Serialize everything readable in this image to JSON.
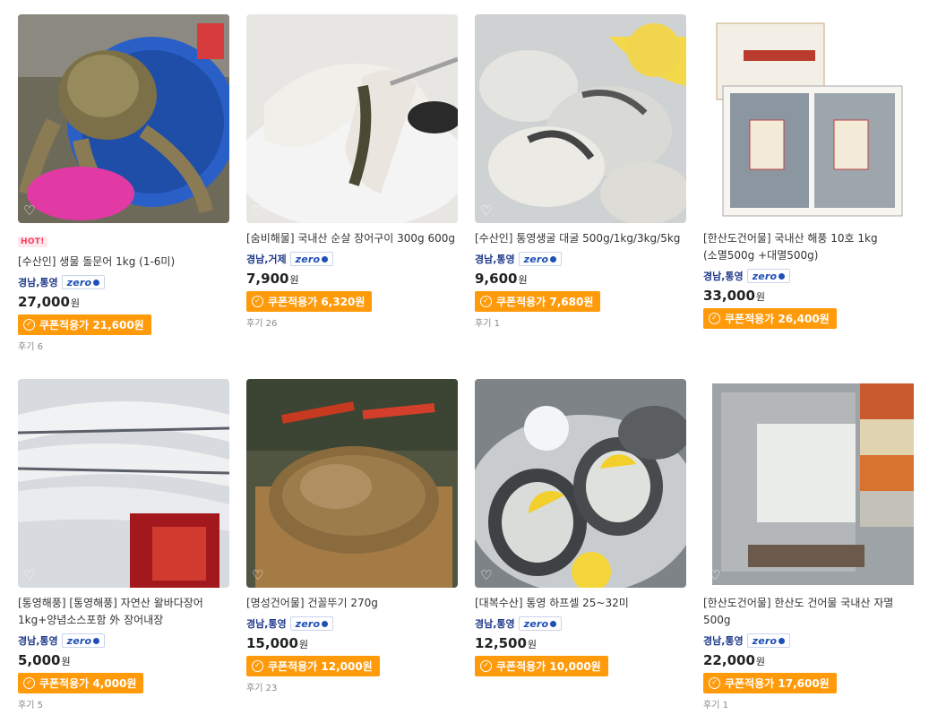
{
  "products": [
    {
      "hot": "HOT!",
      "title": "[수산인] 생물 돌문어 1kg (1-6미)",
      "location": "경남,통영",
      "badge": "zero",
      "price": "27,000",
      "unit": "원",
      "coupon": "쿠폰적용가 21,600원",
      "review": "후기 6"
    },
    {
      "hot": "",
      "title": "[숨비해물] 국내산 순살 장어구이 300g 600g",
      "location": "경남,거제",
      "badge": "zero",
      "price": "7,900",
      "unit": "원",
      "coupon": "쿠폰적용가 6,320원",
      "review": "후기 26"
    },
    {
      "hot": "",
      "title": "[수산인] 통영생굴 대굴 500g/1kg/3kg/5kg",
      "location": "경남,통영",
      "badge": "zero",
      "price": "9,600",
      "unit": "원",
      "coupon": "쿠폰적용가 7,680원",
      "review": "후기 1"
    },
    {
      "hot": "",
      "title": "[한산도건어물] 국내산 해풍 10호 1kg (소멸500g +대멸500g)",
      "location": "경남,통영",
      "badge": "zero",
      "price": "33,000",
      "unit": "원",
      "coupon": "쿠폰적용가 26,400원",
      "review": ""
    },
    {
      "hot": "",
      "title": "[통영해풍] [통영해풍] 자연산 왈바다장어 1kg+양념소스포함 外 장어내장",
      "location": "경남,통영",
      "badge": "zero",
      "price": "5,000",
      "unit": "원",
      "coupon": "쿠폰적용가 4,000원",
      "review": "후기 5"
    },
    {
      "hot": "",
      "title": "[명성건어물] 건꼴뚜기 270g",
      "location": "경남,통영",
      "badge": "zero",
      "price": "15,000",
      "unit": "원",
      "coupon": "쿠폰적용가 12,000원",
      "review": "후기 23"
    },
    {
      "hot": "",
      "title": "[대복수산] 통영 하프셀 25~32미",
      "location": "경남,통영",
      "badge": "zero",
      "price": "12,500",
      "unit": "원",
      "coupon": "쿠폰적용가 10,000원",
      "review": ""
    },
    {
      "hot": "",
      "title": "[한산도건어물] 한산도 건어물 국내산 자멸 500g",
      "location": "경남,통영",
      "badge": "zero",
      "price": "22,000",
      "unit": "원",
      "coupon": "쿠폰적용가 17,600원",
      "review": "후기 1"
    }
  ],
  "icons": {
    "wishlist": "heart-outline-icon",
    "coupon": "check-circle-icon"
  },
  "colors": {
    "coupon_bg": "#ff9a0a",
    "badge_blue": "#1f4fb8",
    "location_text": "#1f3a8a",
    "hot_text": "#ff3b5c"
  }
}
